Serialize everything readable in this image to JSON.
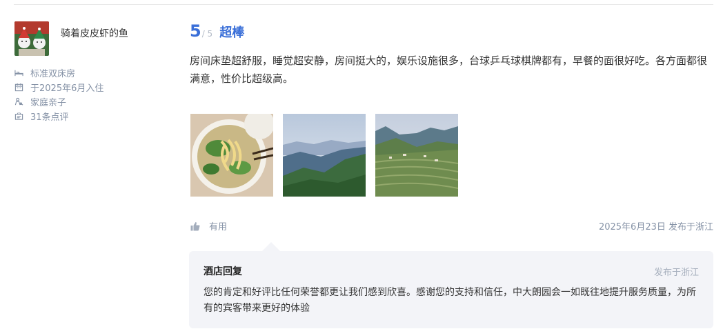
{
  "review": {
    "user": {
      "name": "骑着皮皮虾的鱼",
      "avatar_icon": "christmas-avatar"
    },
    "meta": [
      {
        "icon": "bed-icon",
        "text": "标准双床房"
      },
      {
        "icon": "calendar-icon",
        "text": "于2025年6月入住"
      },
      {
        "icon": "family-icon",
        "text": "家庭亲子"
      },
      {
        "icon": "review-count-icon",
        "text": "31条点评"
      }
    ],
    "rating": {
      "score": "5",
      "max": "/ 5",
      "label": "超棒"
    },
    "text": "房间床垫超舒服，睡觉超安静，房间挺大的，娱乐设施很多，台球乒乓球棋牌都有，早餐的面很好吃。各方面都很满意，性价比超级高。",
    "photos": [
      "noodle-photo",
      "mountain-photo",
      "terrace-photo"
    ],
    "useful_label": "有用",
    "date_location": "2025年6月23日 发布于浙江"
  },
  "hotel_reply": {
    "title": "酒店回复",
    "from": "发布于浙江",
    "text": "您的肯定和好评比任何荣誉都更让我们感到欣喜。感谢您的支持和信任，中大朗园会一如既往地提升服务质量，为所有的宾客带来更好的体验"
  },
  "colors": {
    "accent": "#3a6fd8",
    "muted": "#8592a6",
    "reply_bg": "#f3f4f8"
  }
}
